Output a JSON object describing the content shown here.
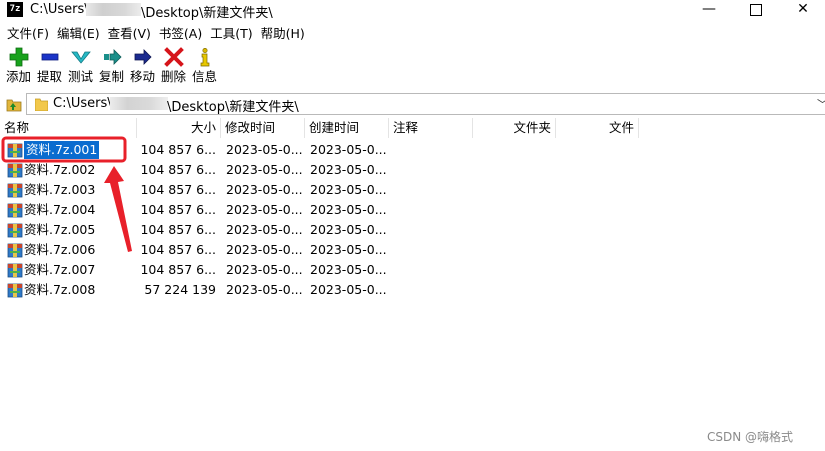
{
  "window": {
    "app_icon_text": "7z",
    "title_prefix": "C:\\Users\\",
    "title_suffix": "\\Desktop\\新建文件夹\\",
    "minimize_glyph": "—",
    "close_glyph": "✕"
  },
  "menu": [
    "文件(F)",
    "编辑(E)",
    "查看(V)",
    "书签(A)",
    "工具(T)",
    "帮助(H)"
  ],
  "toolbar": [
    {
      "label": "添加",
      "icon": "add-icon",
      "color": "#18a21c"
    },
    {
      "label": "提取",
      "icon": "extract-icon",
      "color": "#1b34c8"
    },
    {
      "label": "测试",
      "icon": "test-icon",
      "color": "#27b9c5"
    },
    {
      "label": "复制",
      "icon": "copy-icon",
      "color": "#1a8f8a"
    },
    {
      "label": "移动",
      "icon": "move-icon",
      "color": "#1b2a8f"
    },
    {
      "label": "删除",
      "icon": "delete-icon",
      "color": "#d6141a"
    },
    {
      "label": "信息",
      "icon": "info-icon",
      "color": "#d9b800"
    }
  ],
  "address": {
    "prefix": "C:\\Users\\",
    "suffix": "\\Desktop\\新建文件夹\\",
    "dropdown_glyph": "﹀"
  },
  "columns": [
    "名称",
    "大小",
    "修改时间",
    "创建时间",
    "注释",
    "文件夹",
    "文件"
  ],
  "files": [
    {
      "name": "资料.7z.001",
      "size": "104 857 6...",
      "modified": "2023-05-0...",
      "created": "2023-05-0...",
      "selected": true
    },
    {
      "name": "资料.7z.002",
      "size": "104 857 6...",
      "modified": "2023-05-0...",
      "created": "2023-05-0..."
    },
    {
      "name": "资料.7z.003",
      "size": "104 857 6...",
      "modified": "2023-05-0...",
      "created": "2023-05-0..."
    },
    {
      "name": "资料.7z.004",
      "size": "104 857 6...",
      "modified": "2023-05-0...",
      "created": "2023-05-0..."
    },
    {
      "name": "资料.7z.005",
      "size": "104 857 6...",
      "modified": "2023-05-0...",
      "created": "2023-05-0..."
    },
    {
      "name": "资料.7z.006",
      "size": "104 857 6...",
      "modified": "2023-05-0...",
      "created": "2023-05-0..."
    },
    {
      "name": "资料.7z.007",
      "size": "104 857 6...",
      "modified": "2023-05-0...",
      "created": "2023-05-0..."
    },
    {
      "name": "资料.7z.008",
      "size": "57 224 139",
      "modified": "2023-05-0...",
      "created": "2023-05-0..."
    }
  ],
  "colors": {
    "selection": "#0a6ccf",
    "annotation": "#e8202a"
  },
  "watermark": "CSDN @嗨格式"
}
